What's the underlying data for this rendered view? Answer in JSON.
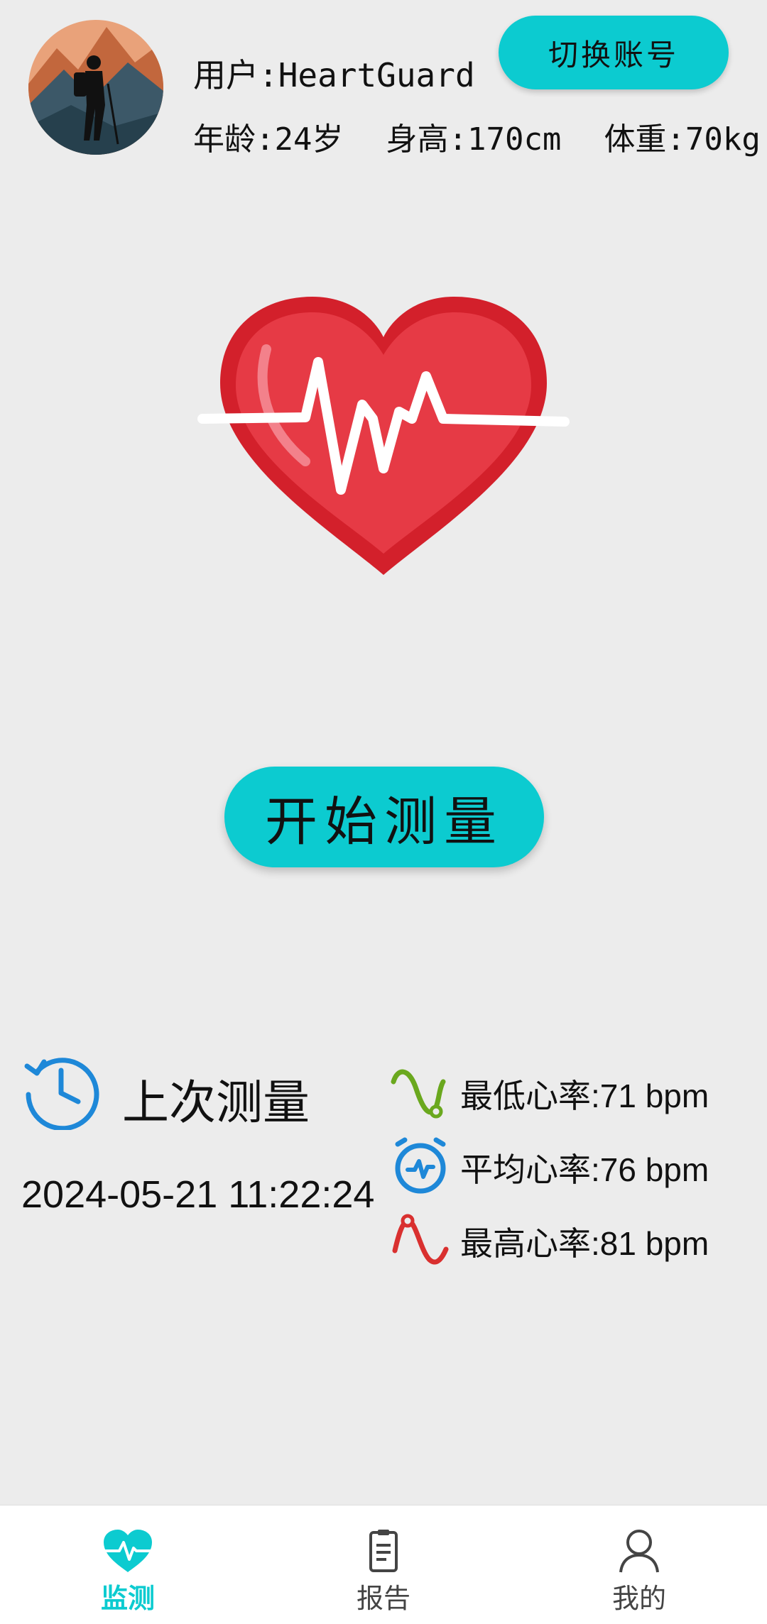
{
  "header": {
    "user_label": "用户:HeartGuard",
    "age": "年龄:24岁",
    "height": "身高:170cm",
    "weight": "体重:70kg",
    "switch_account": "切换账号"
  },
  "main": {
    "start_button": "开始测量"
  },
  "last_measure": {
    "title": "上次测量",
    "time": "2024-05-21 11:22:24",
    "min_rate": "最低心率:71 bpm",
    "avg_rate": "平均心率:76 bpm",
    "max_rate": "最高心率:81 bpm"
  },
  "nav": {
    "items": [
      {
        "label": "监测",
        "icon": "heart-pulse-icon"
      },
      {
        "label": "报告",
        "icon": "clipboard-icon"
      },
      {
        "label": "我的",
        "icon": "person-icon"
      }
    ],
    "active_index": 0
  },
  "colors": {
    "accent": "#0ccbd0",
    "heart": "#e63a45",
    "min_color": "#6aa81e",
    "avg_color": "#1e88d8",
    "max_color": "#d9302f"
  }
}
